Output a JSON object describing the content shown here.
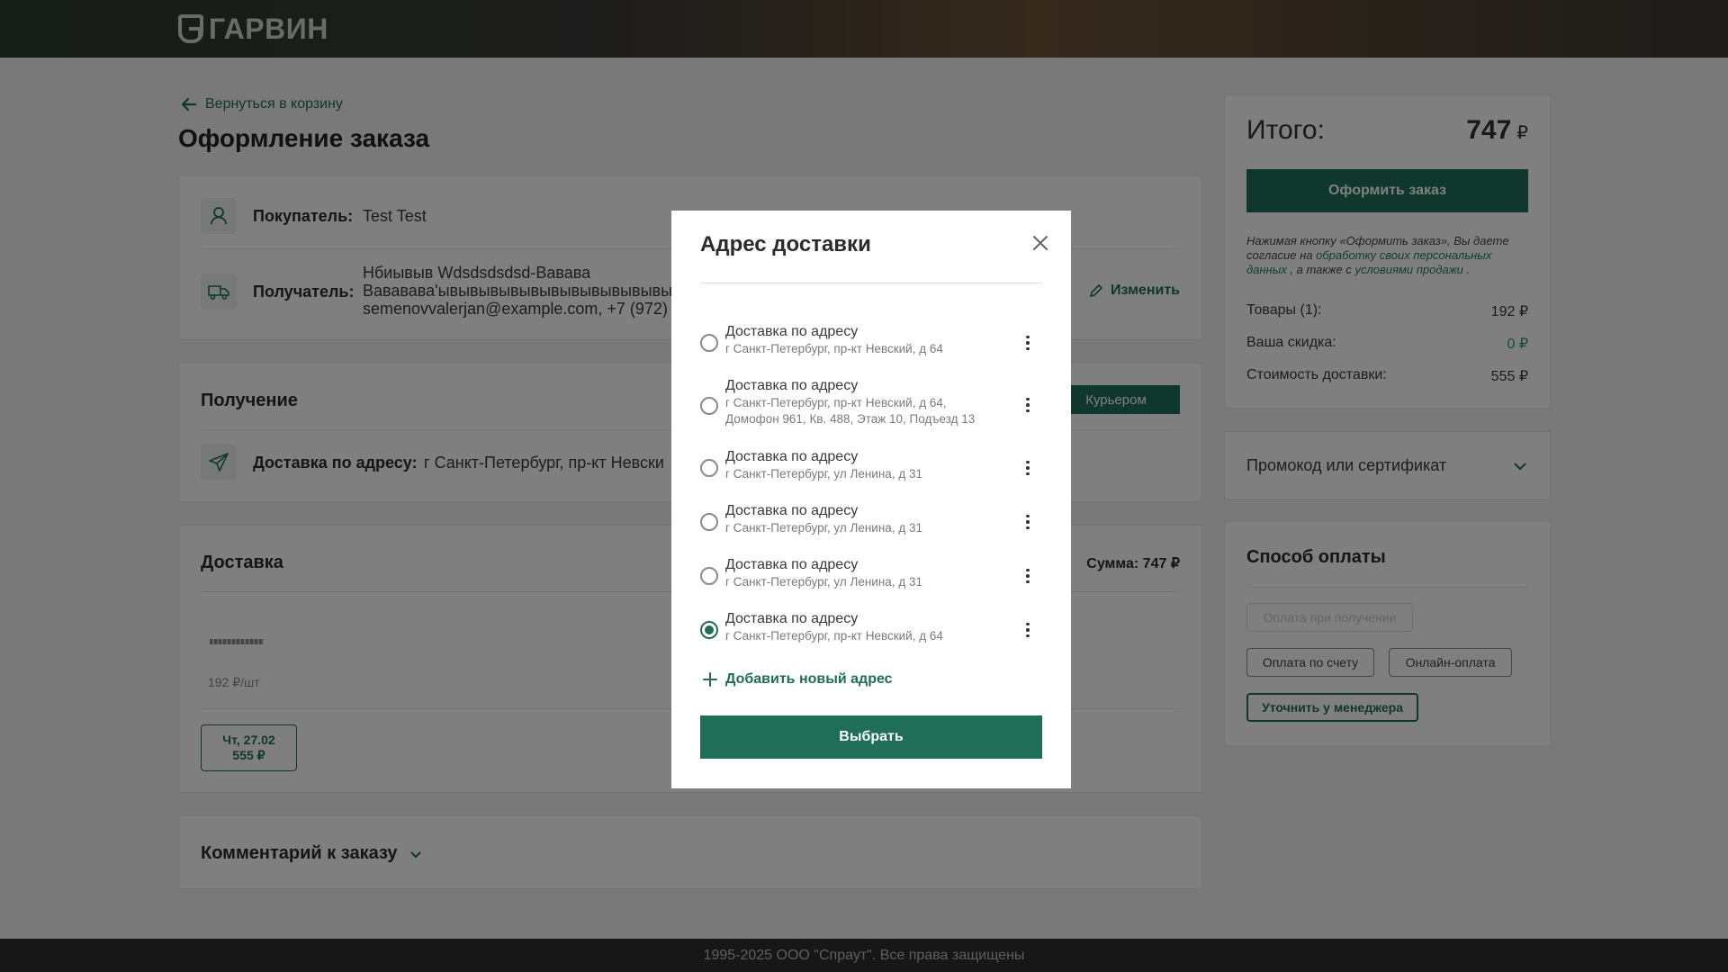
{
  "header": {
    "logo_text": "ГАРВИН"
  },
  "checkout": {
    "back_label": "Вернуться в корзину",
    "title": "Оформление заказа",
    "buyer": {
      "label": "Покупатель:",
      "value": "Test Test"
    },
    "recipient": {
      "label": "Получатель:",
      "line1": "Нбиывыв Wdsdsdsdsd-Вавава",
      "line2": "Вавававаʹывывывывывывывывывывывы",
      "line3": "semenovvalerjan@example.com, +7 (972)",
      "edit_label": "Изменить"
    },
    "receipt": {
      "title": "Получение",
      "courier_label": "Курьером",
      "address_label": "Доставка по адресу:",
      "address_value": "г Санкт-Петербург, пр-кт Невски"
    },
    "delivery": {
      "title": "Доставка",
      "sum_label": "Сумма: 747 ₽",
      "unit_price": "192 ₽/шт",
      "date_chip_line1": "Чт, 27.02",
      "date_chip_line2": "555 ₽"
    },
    "comment": {
      "title": "Комментарий к заказу"
    }
  },
  "summary": {
    "total_label": "Итого:",
    "total_value": "747",
    "currency": "₽",
    "place_order": "Оформить заказ",
    "consent_prefix": "Нажимая кнопку «Оформить заказ», Вы даете согласие на ",
    "consent_link1": "обработку своих персональных данных",
    "consent_middle": " , а также с ",
    "consent_link2": "условиями продажи",
    "consent_suffix": " .",
    "rows": [
      {
        "label": "Товары (1):",
        "value": "192 ₽"
      },
      {
        "label": "Ваша скидка:",
        "value": "0 ₽"
      },
      {
        "label": "Стоимость доставки:",
        "value": "555 ₽"
      }
    ],
    "promo_label": "Промокод или сертификат",
    "payment_title": "Способ оплаты",
    "payment_options": [
      "Оплата при получении",
      "Оплата по счету",
      "Онлайн-оплата",
      "Уточнить у менеджера"
    ]
  },
  "modal": {
    "title": "Адрес доставки",
    "addresses": [
      {
        "title": "Доставка по адресу",
        "text": "г Санкт-Петербург, пр-кт Невский, д 64",
        "checked": false
      },
      {
        "title": "Доставка по адресу",
        "text": "г Санкт-Петербург, пр-кт Невский, д 64, Домофон 961, Кв. 488, Этаж 10, Подъезд 13",
        "checked": false
      },
      {
        "title": "Доставка по адресу",
        "text": "г Санкт-Петербург, ул Ленина, д 31",
        "checked": false
      },
      {
        "title": "Доставка по адресу",
        "text": "г Санкт-Петербург, ул Ленина, д 31",
        "checked": false
      },
      {
        "title": "Доставка по адресу",
        "text": "г Санкт-Петербург, ул Ленина, д 31",
        "checked": false
      },
      {
        "title": "Доставка по адресу",
        "text": "г Санкт-Петербург, пр-кт Невский, д 64",
        "checked": true
      }
    ],
    "add_label": "Добавить новый адрес",
    "select_label": "Выбрать"
  },
  "footer": {
    "text": "1995-2025 ООО \"Спраут\". Все права защищены"
  },
  "colors": {
    "accent": "#1f6e57",
    "footer_bg": "#2f2f2f"
  }
}
